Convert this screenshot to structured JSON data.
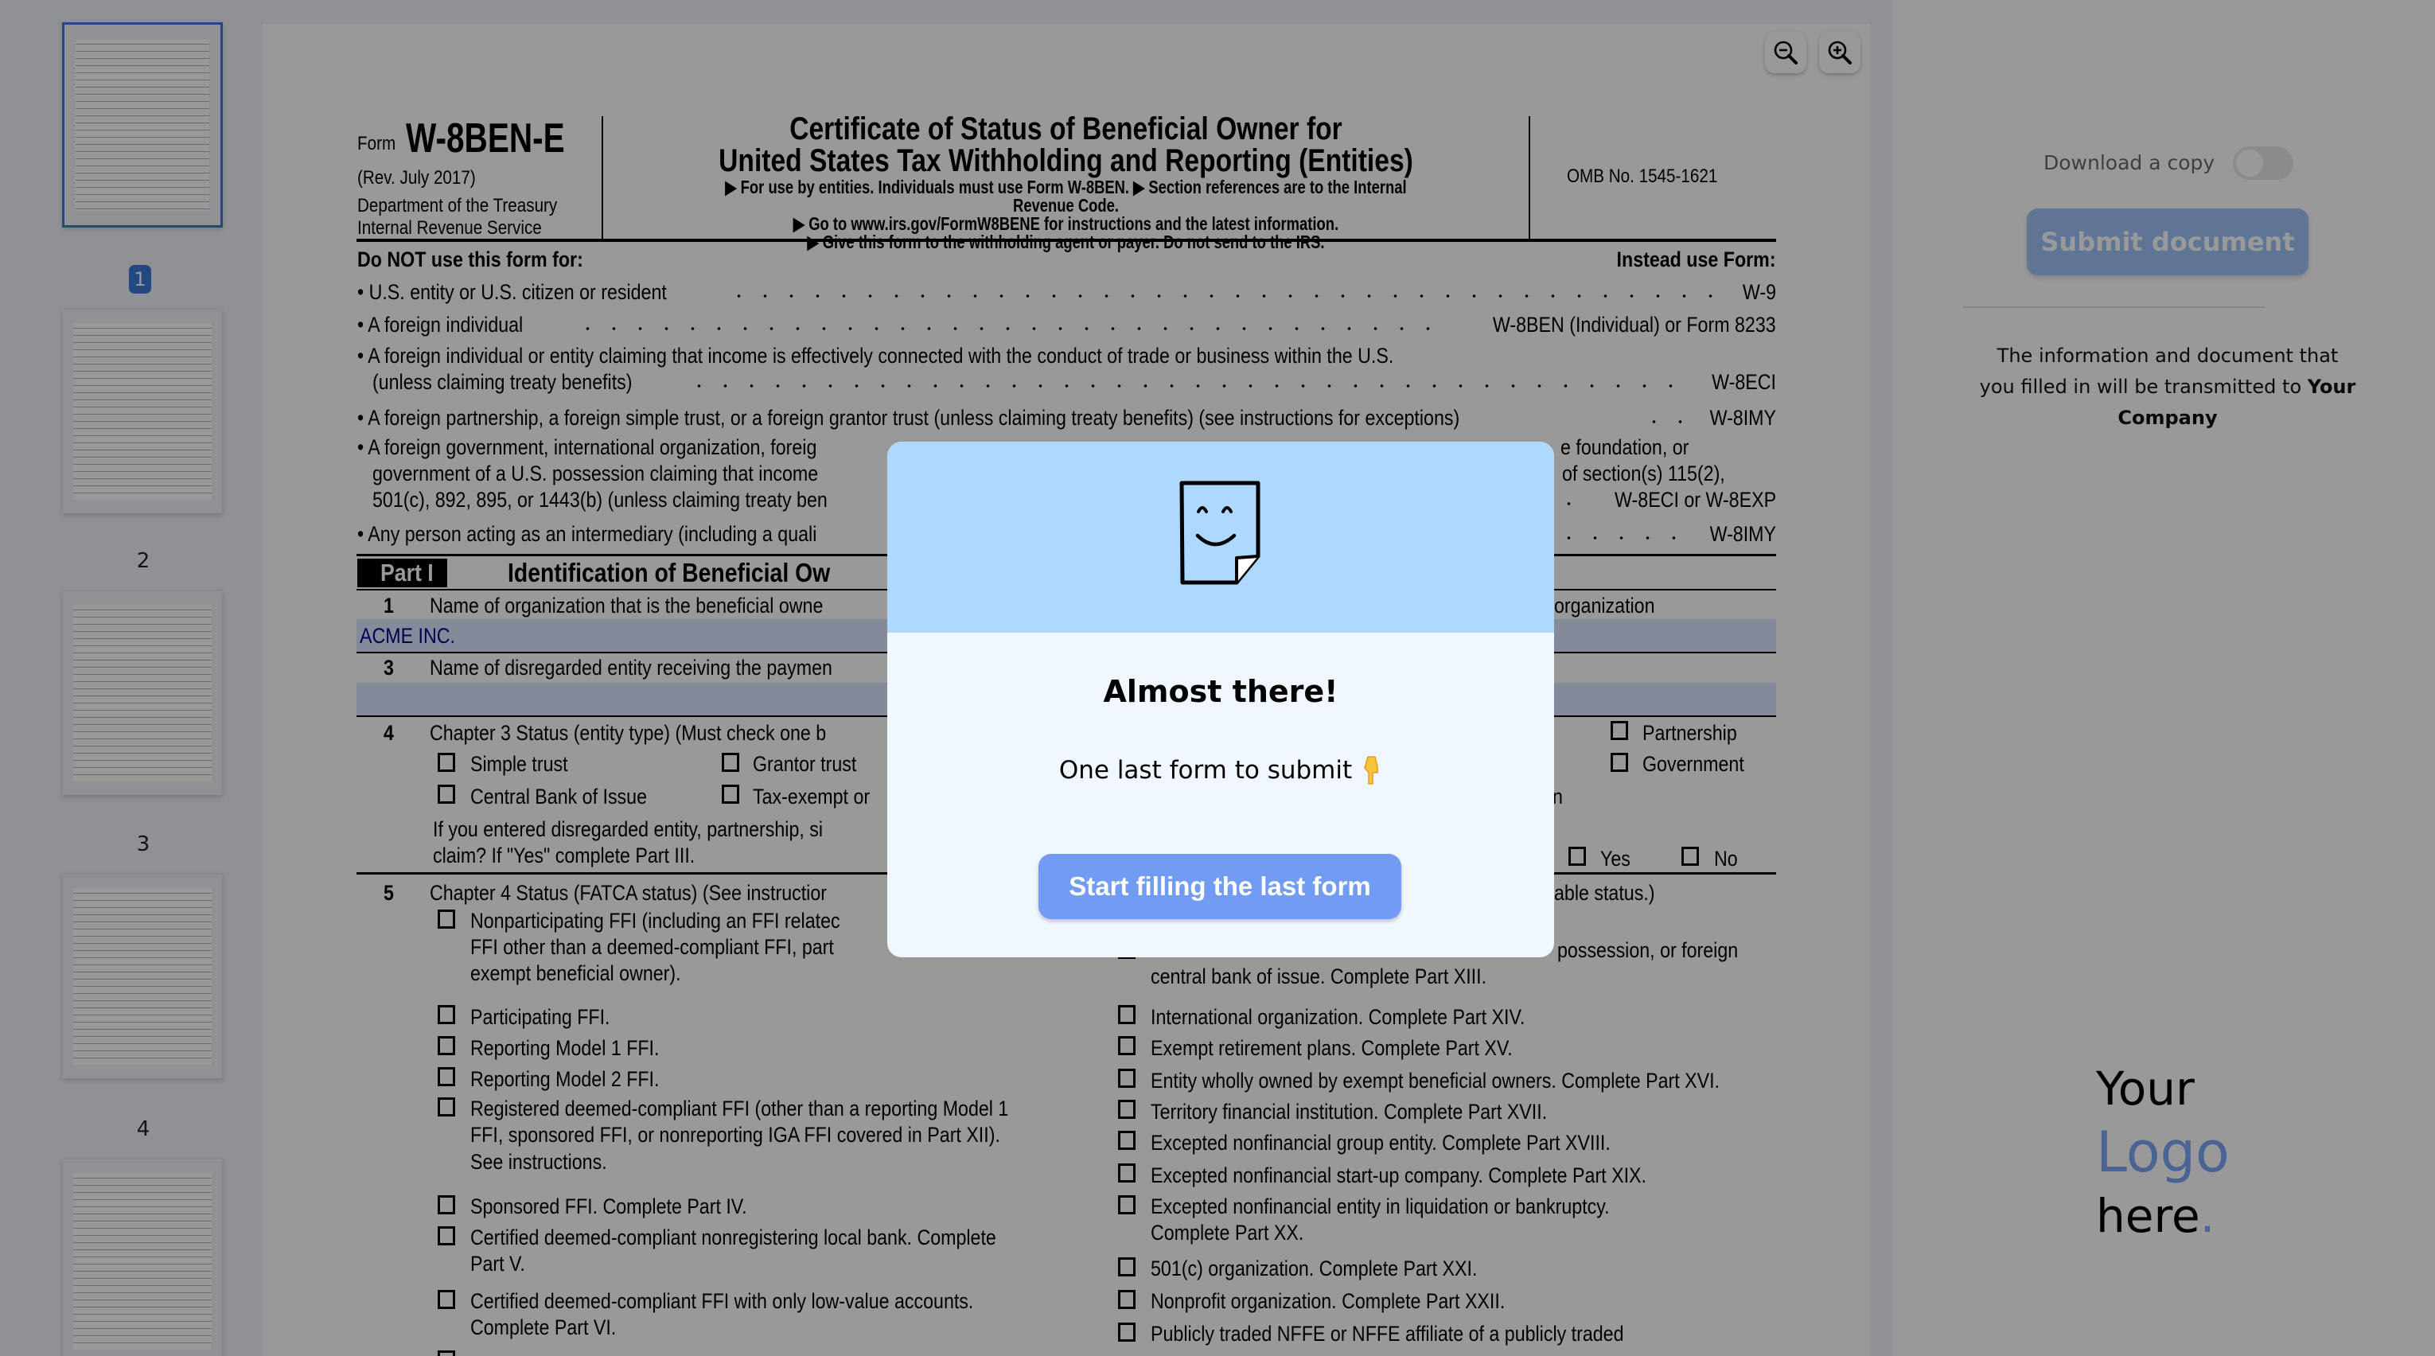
{
  "sidebar": {
    "pages": [
      {
        "label": "1"
      },
      {
        "label": "2"
      },
      {
        "label": "3"
      },
      {
        "label": "4"
      }
    ]
  },
  "toolbar": {
    "zoom_out_icon": "zoom-out-icon",
    "zoom_in_icon": "zoom-in-icon"
  },
  "form": {
    "form_word": "Form",
    "form_number": "W-8BEN-E",
    "revision": "(Rev. July 2017)",
    "dept": "Department of the Treasury",
    "irs": "Internal Revenue Service",
    "title1": "Certificate of Status of Beneficial Owner for",
    "title2": "United States Tax Withholding and Reporting (Entities)",
    "sub1": "▶ For use by entities. Individuals must use Form W-8BEN. ▶ Section references are to the Internal Revenue Code.",
    "sub2": "▶ Go to www.irs.gov/FormW8BENE for instructions and the latest information.",
    "sub3": "▶ Give this form to the withholding agent or payer. Do not send to the IRS.",
    "omb": "OMB No. 1545-1621",
    "do_not": "Do NOT use this form for:",
    "instead": "Instead use Form:",
    "rows": [
      {
        "text": "• U.S. entity or U.S. citizen or resident",
        "form": "W-9"
      },
      {
        "text": "• A foreign individual",
        "form": "W-8BEN (Individual) or Form 8233"
      },
      {
        "text": "• A foreign individual or entity claiming that income is effectively connected with the conduct of trade or business within the U.S."
      },
      {
        "text": "(unless claiming treaty benefits)",
        "form": "W-8ECI"
      },
      {
        "text": "• A foreign partnership, a foreign simple trust, or a foreign grantor trust (unless claiming treaty benefits) (see instructions for exceptions)",
        "form": "W-8IMY"
      },
      {
        "text": "• A foreign government, international organization, foreig",
        "right": "e foundation, or"
      },
      {
        "text": "government of a U.S. possession claiming that income",
        "right": "of section(s) 115(2),"
      },
      {
        "text": "501(c), 892, 895, or 1443(b) (unless claiming treaty ben",
        "form": "W-8ECI or W-8EXP"
      },
      {
        "text": "• Any person acting as an intermediary (including a quali",
        "form": "W-8IMY"
      }
    ],
    "part1_label": "Part I",
    "part1_title": "Identification of Beneficial Ow",
    "line1_num": "1",
    "line1": "Name of organization that is the beneficial owne",
    "line1_right": "organization",
    "line1_value": "ACME INC.",
    "line3_num": "3",
    "line3": "Name of disregarded entity receiving the paymen",
    "line4_num": "4",
    "line4": "Chapter 3 Status (entity type) (Must check one b",
    "ch3": {
      "simple_trust": "Simple trust",
      "grantor_trust": "Grantor trust",
      "central_bank": "Central Bank of Issue",
      "tax_exempt": "Tax-exempt or",
      "partnership": "Partnership",
      "government": "Government",
      "frag": "n"
    },
    "line4b1": "If you entered disregarded entity, partnership, si",
    "line4b2": "claim? If \"Yes\" complete Part III.",
    "yes": "Yes",
    "no": "No",
    "line5_num": "5",
    "line5": "Chapter 4 Status (FATCA status) (See instructior",
    "line5_right": "able status.)",
    "left_col": [
      "Nonparticipating FFI (including an FFI relatec",
      "FFI other than a deemed-compliant FFI, part",
      "exempt beneficial owner).",
      "Participating FFI.",
      "Reporting Model 1 FFI.",
      "Reporting Model 2 FFI.",
      "Registered deemed-compliant FFI (other than a reporting Model 1",
      "FFI, sponsored FFI, or nonreporting IGA FFI covered in Part XII).",
      "See instructions.",
      "Sponsored FFI. Complete Part IV.",
      "Certified deemed-compliant nonregistering local bank. Complete",
      "Part V.",
      "Certified deemed-compliant FFI with only low-value accounts.",
      "Complete Part VI."
    ],
    "right_col": [
      "possession, or foreign",
      "central bank of issue. Complete Part XIII.",
      "International organization. Complete Part XIV.",
      "Exempt retirement plans. Complete Part XV.",
      "Entity wholly owned by exempt beneficial owners. Complete Part XVI.",
      "Territory financial institution. Complete Part XVII.",
      "Excepted nonfinancial group entity. Complete Part XVIII.",
      "Excepted nonfinancial start-up company. Complete Part XIX.",
      "Excepted nonfinancial entity in liquidation or bankruptcy.",
      "Complete Part XX.",
      "501(c) organization. Complete Part XXI.",
      "Nonprofit organization. Complete Part XXII.",
      "Publicly traded NFFE or NFFE affiliate of a publicly traded"
    ]
  },
  "panel": {
    "download_label": "Download a copy",
    "download_toggle_on": false,
    "submit_label": "Submit document",
    "info_1": "The information and document that",
    "info_2": "you filled in will be transmitted to",
    "company": "Your",
    "company2": "Company",
    "logo": {
      "line1": "Your",
      "line2": "Logo",
      "line3": "here",
      "dot": "."
    }
  },
  "modal": {
    "title": "Almost there!",
    "subtitle": "One last form to submit",
    "subtitle_icon": "pointing-down-hand-icon",
    "button": "Start filling the last form",
    "illustration": "smiling-document-icon"
  },
  "colors": {
    "accent": "#729cf3",
    "modal_header": "#aed8fd",
    "modal_body": "#f1f7ff",
    "badge": "#3c78d8",
    "logo_blue": "#4a6fc8",
    "field_value": "#00008b"
  }
}
